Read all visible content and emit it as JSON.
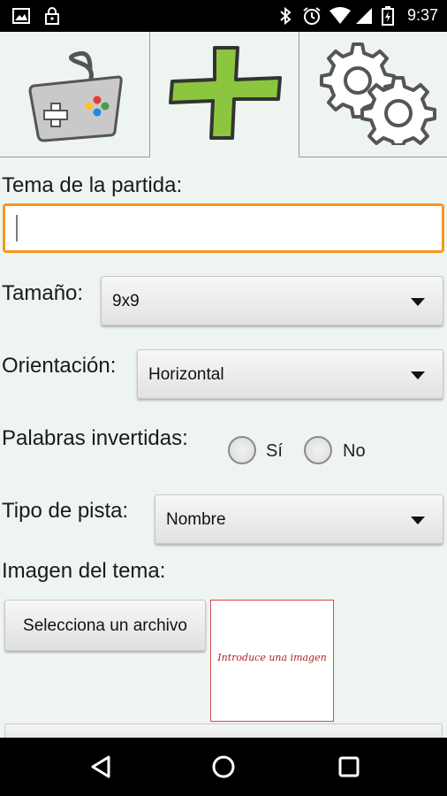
{
  "status_bar": {
    "time": "9:37",
    "icons": [
      "image-icon",
      "lock-icon",
      "bluetooth-icon",
      "alarm-icon",
      "wifi-icon",
      "signal-icon",
      "battery-icon"
    ]
  },
  "tabs": [
    {
      "name": "tab-play",
      "icon": "gamepad-icon"
    },
    {
      "name": "tab-new",
      "icon": "plus-icon"
    },
    {
      "name": "tab-settings",
      "icon": "gears-icon"
    }
  ],
  "form": {
    "topic_label": "Tema de la partida:",
    "topic_value": "",
    "size_label": "Tamaño:",
    "size_value": "9x9",
    "orientation_label": "Orientación:",
    "orientation_value": "Horizontal",
    "inverted_label": "Palabras invertidas:",
    "inverted_options": [
      "Sí",
      "No"
    ],
    "hint_label": "Tipo de pista:",
    "hint_value": "Nombre",
    "image_label": "Imagen del tema:",
    "select_file_button": "Selecciona un archivo",
    "image_placeholder": "Introduce una imagen"
  },
  "colors": {
    "accent_orange": "#f39a1e",
    "background": "#eef4ef",
    "plus_green": "#8cc63f",
    "image_border": "#d84a4a"
  },
  "nav_bar": {
    "icons": [
      "back-icon",
      "home-icon",
      "recents-icon"
    ]
  }
}
